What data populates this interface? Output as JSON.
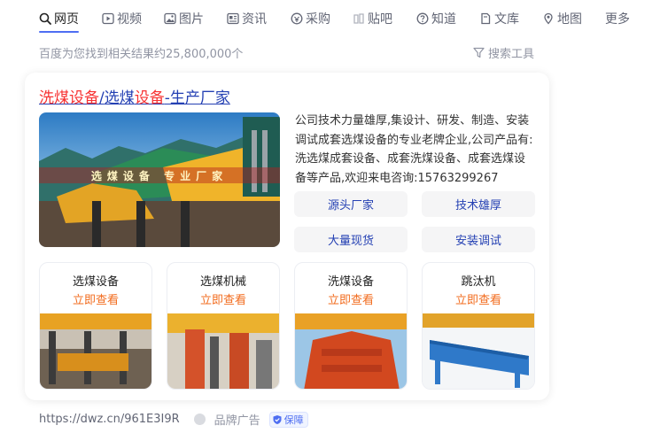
{
  "tabs": [
    {
      "label": "网页",
      "icon": "search-icon",
      "active": true
    },
    {
      "label": "视频",
      "icon": "video-icon"
    },
    {
      "label": "图片",
      "icon": "image-icon"
    },
    {
      "label": "资讯",
      "icon": "news-icon"
    },
    {
      "label": "采购",
      "icon": "purchase-icon"
    },
    {
      "label": "贴吧",
      "icon": "tieba-icon"
    },
    {
      "label": "知道",
      "icon": "question-icon"
    },
    {
      "label": "文库",
      "icon": "doc-icon"
    },
    {
      "label": "地图",
      "icon": "map-icon"
    },
    {
      "label": "更多"
    }
  ],
  "result_count": "百度为您找到相关结果约25,800,000个",
  "search_tools": {
    "label": "搜索工具",
    "icon": "filter-icon"
  },
  "result": {
    "title_parts": [
      "洗煤设备",
      "/",
      "选煤",
      "设备",
      "-生产厂家"
    ],
    "image_banner_text": "选煤设备 专业厂家",
    "description": "公司技术力量雄厚,集设计、研发、制造、安装调试成套选煤设备的专业老牌企业,公司产品有:洗选煤成套设备、成套洗煤设备、成套选煤设备等产品,欢迎来电咨询:15763299267",
    "chips": [
      "源头厂家",
      "技术雄厚",
      "大量现货",
      "安装调试"
    ],
    "products": [
      {
        "name": "选煤设备",
        "cta": "立即查看"
      },
      {
        "name": "选煤机械",
        "cta": "立即查看"
      },
      {
        "name": "洗煤设备",
        "cta": "立即查看"
      },
      {
        "name": "跳汰机",
        "cta": "立即查看"
      }
    ]
  },
  "footer": {
    "url": "https://dwz.cn/961E3I9R",
    "ad_label": "品牌广告",
    "badge": "保障"
  },
  "colors": {
    "link": "#2440b3",
    "highlight": "#f73131",
    "cta": "#f26b1d",
    "accent": "#4e6ef2"
  }
}
